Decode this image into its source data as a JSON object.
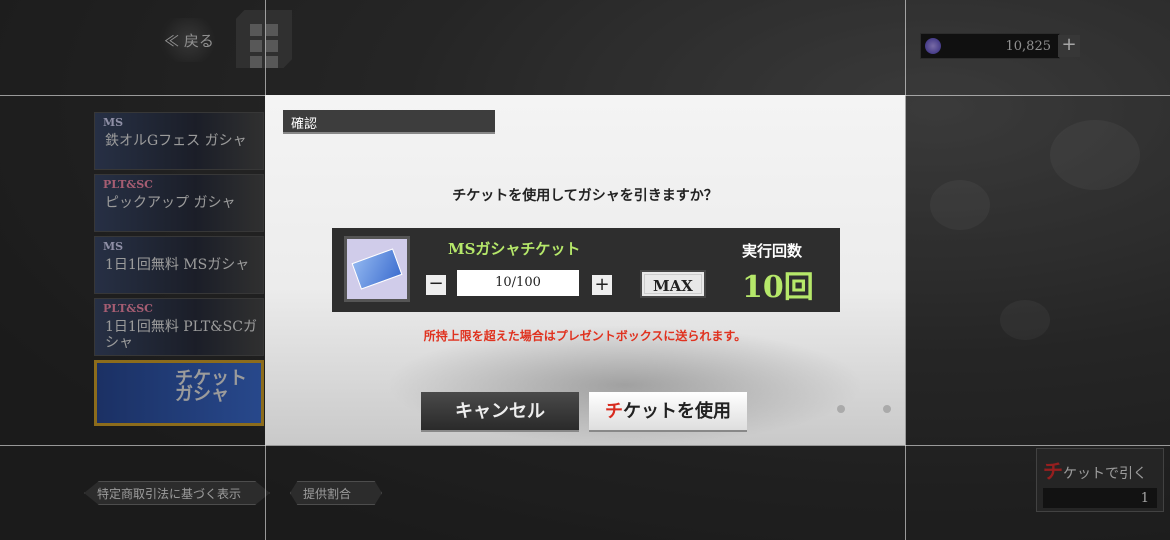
{
  "top": {
    "back_label": "≪ 戻る",
    "currency_value": "10,825",
    "currency_plus": "+"
  },
  "banners": [
    {
      "tag": "MS",
      "name": "鉄オルGフェス ガシャ"
    },
    {
      "tag": "PLT&SC",
      "name": "ピックアップ ガシャ"
    },
    {
      "tag": "MS",
      "name": "1日1回無料 MSガシャ"
    },
    {
      "tag": "PLT&SC",
      "name": "1日1回無料 PLT&SCガシャ"
    },
    {
      "tag": "",
      "name": "チケット ガシャ"
    }
  ],
  "bottom": {
    "legal_link": "特定商取引法に基づく表示",
    "rates_link": "提供割合",
    "draw_button_first": "チ",
    "draw_button_rest": "ケットで引く",
    "draw_button_count": "1"
  },
  "dialog": {
    "title": "確認",
    "question": "チケットを使用してガシャを引きますか？",
    "ticket_name": "MSガシャチケット",
    "minus": "−",
    "quantity": "10/100",
    "plus": "+",
    "max_label": "MAX",
    "exec_label": "実行回数",
    "exec_value": "10回",
    "warning": "所持上限を超えた場合はプレゼントボックスに送られます。",
    "cancel_label": "キャンセル",
    "use_label_first": "チ",
    "use_label_rest": "ケットを使用"
  },
  "colors": {
    "accent_green": "#b6e86a",
    "warning_red": "#e0321f",
    "ticket_banner_border": "#d7a62b"
  }
}
